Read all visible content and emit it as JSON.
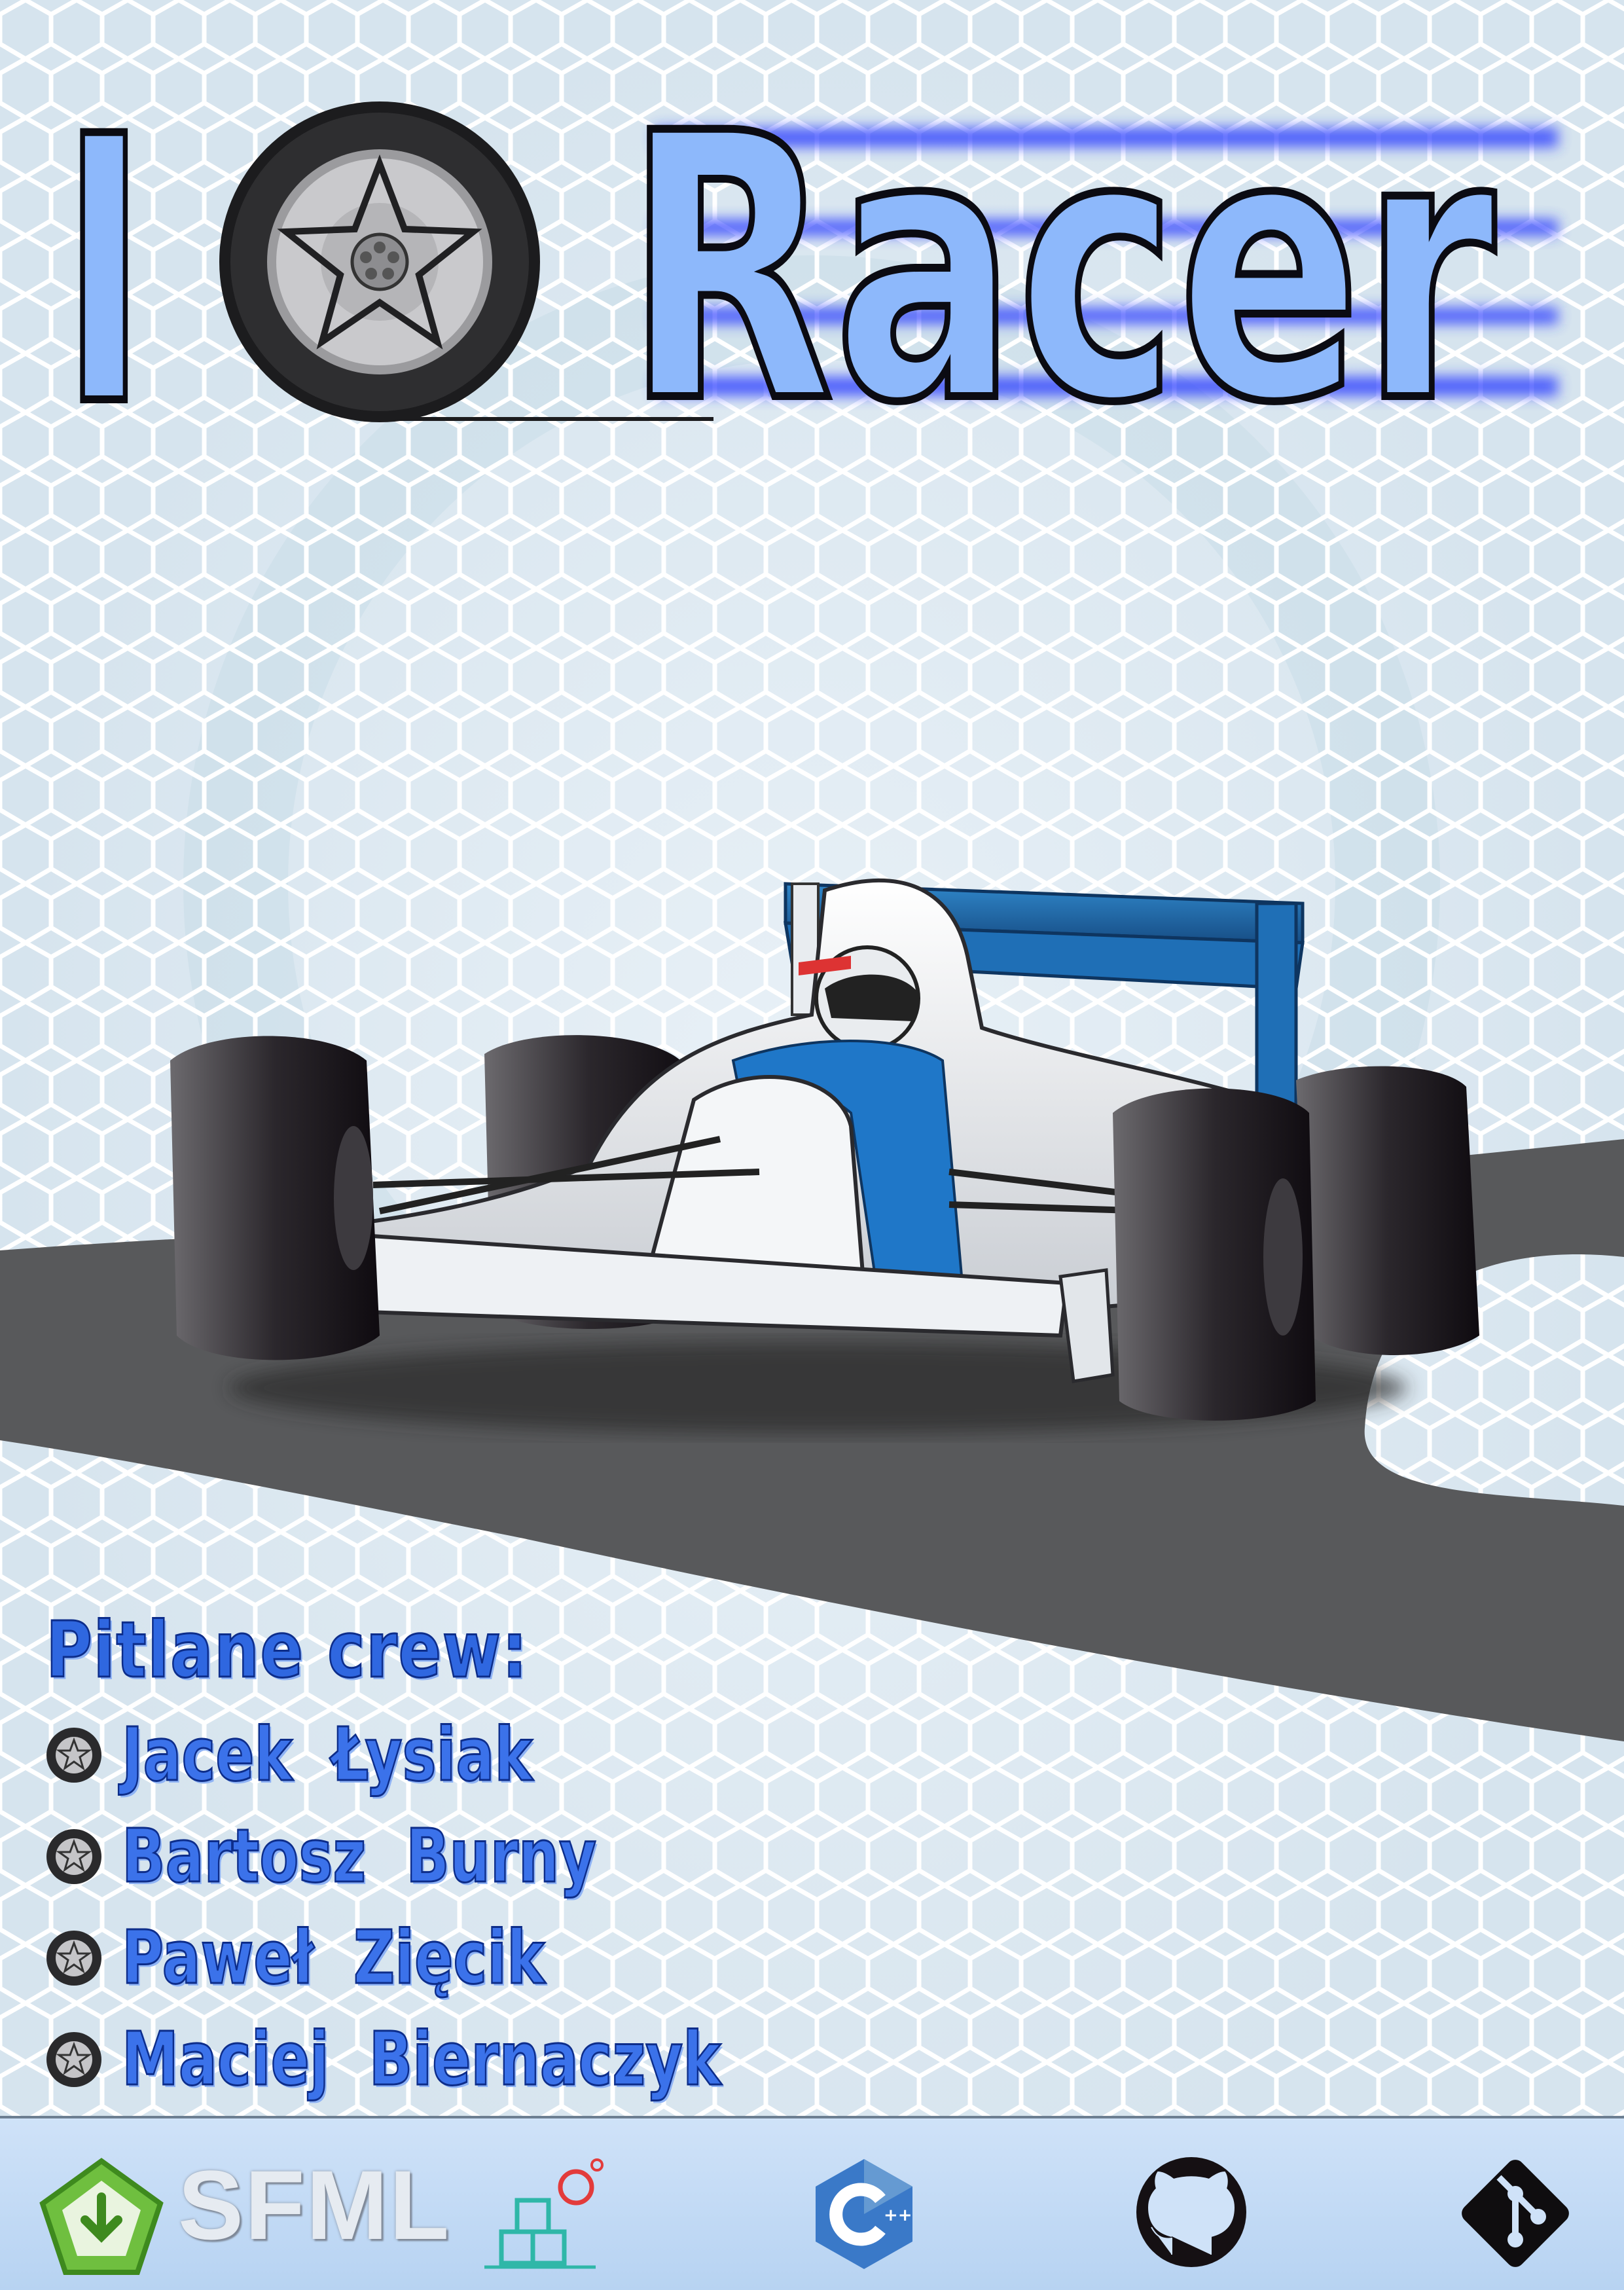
{
  "poster": {
    "title_letter": "I",
    "title_word": "Racer"
  },
  "crew": {
    "heading": "Pitlane crew:",
    "members": [
      {
        "name": "Jacek  Łysiak"
      },
      {
        "name": "Bartosz  Burny"
      },
      {
        "name": "Paweł  Zięcik"
      },
      {
        "name": "Maciej  Biernaczyk"
      }
    ]
  },
  "footer": {
    "sfml_label": "SFML",
    "logos": [
      "sfml-logo",
      "box2d-icon",
      "cpp-icon",
      "github-icon",
      "git-icon"
    ]
  },
  "colors": {
    "title_blue": "#8db8fb",
    "crew_blue": "#3b72ea",
    "track_gray": "#58595b",
    "car_blue": "#1f6fb6"
  }
}
